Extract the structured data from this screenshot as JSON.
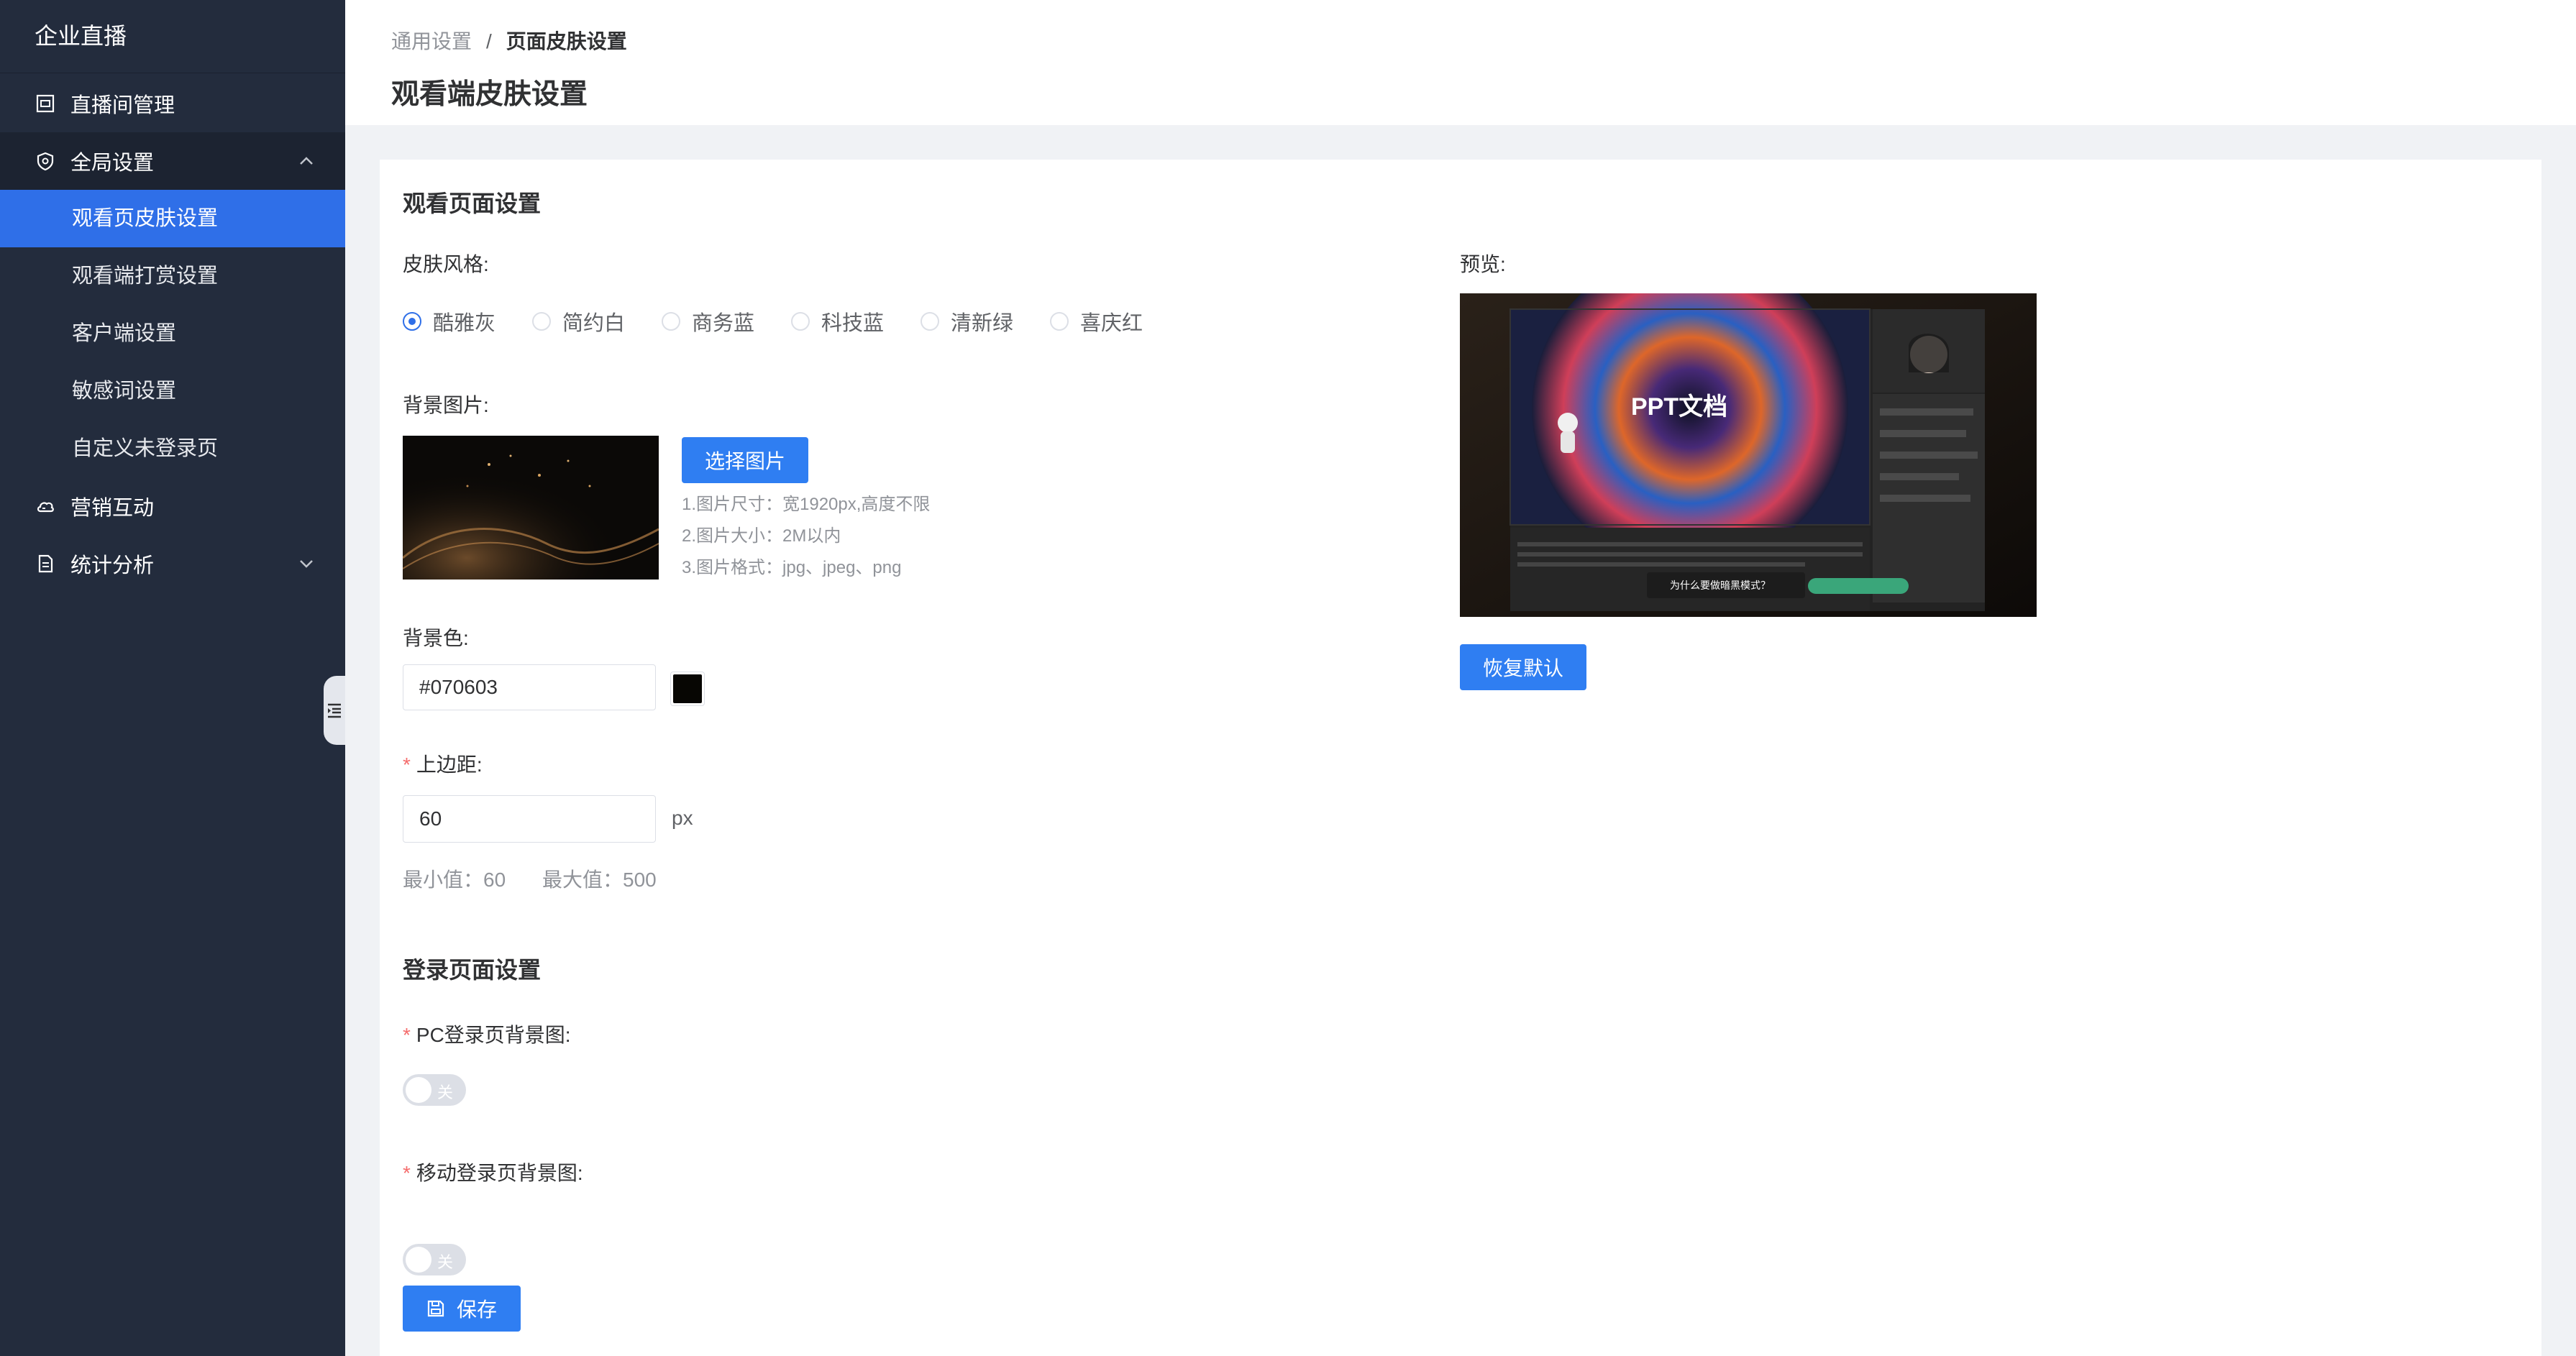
{
  "app": {
    "title": "企业直播"
  },
  "sidebar": {
    "items": [
      {
        "label": "直播间管理",
        "icon": "monitor-icon"
      },
      {
        "label": "全局设置",
        "icon": "shield-icon",
        "expanded": true,
        "children": [
          {
            "label": "观看页皮肤设置",
            "active": true
          },
          {
            "label": "观看端打赏设置"
          },
          {
            "label": "客户端设置"
          },
          {
            "label": "敏感词设置"
          },
          {
            "label": "自定义未登录页"
          }
        ]
      },
      {
        "label": "营销互动",
        "icon": "cloud-icon"
      },
      {
        "label": "统计分析",
        "icon": "document-icon",
        "expanded": false
      }
    ]
  },
  "header": {
    "breadcrumb": [
      "通用设置",
      "页面皮肤设置"
    ],
    "breadcrumb_sep": "/",
    "title": "观看端皮肤设置"
  },
  "watch": {
    "section_title": "观看页面设置",
    "skin_label": "皮肤风格:",
    "skins": [
      "酷雅灰",
      "简约白",
      "商务蓝",
      "科技蓝",
      "清新绿",
      "喜庆红"
    ],
    "selected_skin": "酷雅灰",
    "bg_image_label": "背景图片:",
    "choose_image_button": "选择图片",
    "hints": [
      "1.图片尺寸：宽1920px,高度不限",
      "2.图片大小：2M以内",
      "3.图片格式：jpg、jpeg、png"
    ],
    "bg_color_label": "背景色:",
    "bg_color_value": "#070603",
    "swatch_color": "#070603",
    "margin_label": "上边距:",
    "margin_value": "60",
    "margin_unit": "px",
    "min_text": "最小值：60",
    "max_text": "最大值：500",
    "preview_label": "预览:",
    "preview_title": "PPT文档",
    "preview_question": "为什么要做暗黑模式？",
    "restore_button": "恢复默认"
  },
  "login": {
    "section_title": "登录页面设置",
    "pc_label": "PC登录页背景图:",
    "pc_toggle": "关",
    "mobile_label": "移动登录页背景图:",
    "mobile_toggle": "关",
    "save_button": "保存"
  },
  "colors": {
    "accent": "#2f7ef2",
    "sidebar_bg": "#232c3d",
    "active_bg": "#2f6fe8",
    "required": "#f56c6c"
  }
}
